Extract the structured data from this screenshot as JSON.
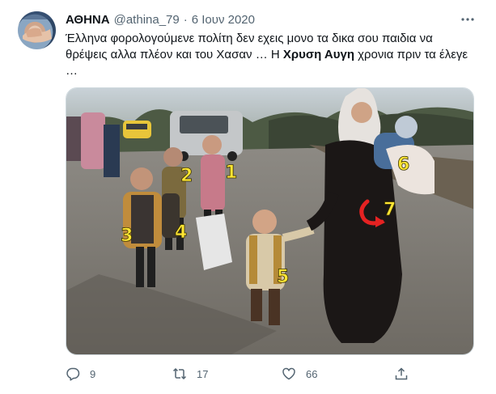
{
  "author": {
    "name": "ΑΘΗΝΑ",
    "handle": "@athina_79",
    "separator": "·",
    "date": "6 Ιουν 2020"
  },
  "tweet": {
    "line1": "Έλληνα φορολογούμενε πολίτη δεν εχεις μονο τα δικα σου παιδια να",
    "line2_part1": "θρέψεις αλλα πλέον και του Χασαν … Η ",
    "line2_bold": "Χρυση Αυγη",
    "line2_part2": " χρονια πριν τα έλεγε",
    "line3": "…"
  },
  "image_labels": [
    "1",
    "2",
    "3",
    "4",
    "5",
    "6",
    "7"
  ],
  "actions": {
    "reply_count": "9",
    "retweet_count": "17",
    "like_count": "66"
  },
  "colors": {
    "text": "#0f1419",
    "secondary": "#536471",
    "label_yellow": "#ffe634",
    "arrow_red": "#e52222"
  },
  "icons": [
    "more-icon",
    "reply-icon",
    "retweet-icon",
    "like-icon",
    "share-icon"
  ]
}
